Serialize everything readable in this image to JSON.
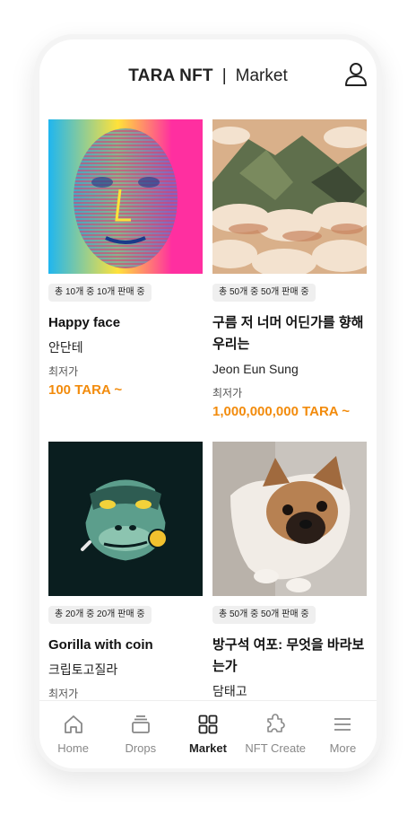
{
  "header": {
    "brand": "TARA NFT",
    "separator": "|",
    "section": "Market"
  },
  "cards": [
    {
      "badge": "총 10개 중 10개 판매 중",
      "title": "Happy face",
      "creator": "안단테",
      "price_label": "최저가",
      "price": "100 TARA ~",
      "image_icon": "abstract-face-art"
    },
    {
      "badge": "총 50개 중 50개 판매 중",
      "title": "구름 저 너머 어딘가를 향해 우리는",
      "creator": "Jeon Eun Sung",
      "price_label": "최저가",
      "price": "1,000,000,000 TARA ~",
      "image_icon": "mountain-clouds-art"
    },
    {
      "badge": "총 20개 중 20개 판매 중",
      "title": "Gorilla with coin",
      "creator": "크립토고질라",
      "price_label": "최저가",
      "price": "",
      "image_icon": "gorilla-coin-art"
    },
    {
      "badge": "총 50개 중 50개 판매 중",
      "title": "방구석 여포: 무엇을 바라보는가",
      "creator": "담태고",
      "price_label": "",
      "price": "",
      "image_icon": "puppy-photo"
    }
  ],
  "tabs": [
    {
      "label": "Home",
      "icon": "home-icon",
      "active": false
    },
    {
      "label": "Drops",
      "icon": "drops-icon",
      "active": false
    },
    {
      "label": "Market",
      "icon": "market-grid-icon",
      "active": true
    },
    {
      "label": "NFT Create",
      "icon": "puzzle-icon",
      "active": false
    },
    {
      "label": "More",
      "icon": "menu-icon",
      "active": false
    }
  ],
  "colors": {
    "accent_price": "#f28b0c",
    "active_tab": "#222222",
    "inactive_tab": "#888888"
  }
}
